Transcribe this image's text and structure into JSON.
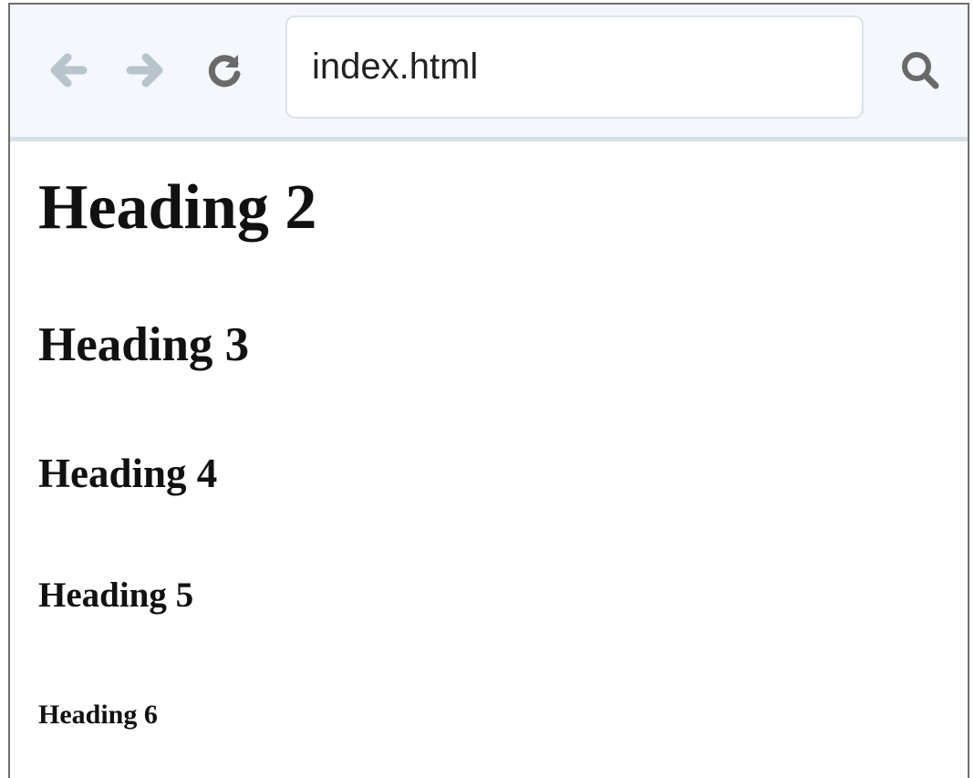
{
  "browser": {
    "address": "index.html",
    "icons": {
      "back": "arrow-left-icon",
      "forward": "arrow-right-icon",
      "reload": "reload-icon",
      "search": "search-icon"
    },
    "colors": {
      "disabled_nav": "#b8c4cb",
      "active_icon": "#6a6a6a",
      "toolbar_bg": "#f4f7fb"
    }
  },
  "page": {
    "headings": {
      "h2": "Heading 2",
      "h3": "Heading 3",
      "h4": "Heading 4",
      "h5": "Heading 5",
      "h6": "Heading 6"
    }
  }
}
